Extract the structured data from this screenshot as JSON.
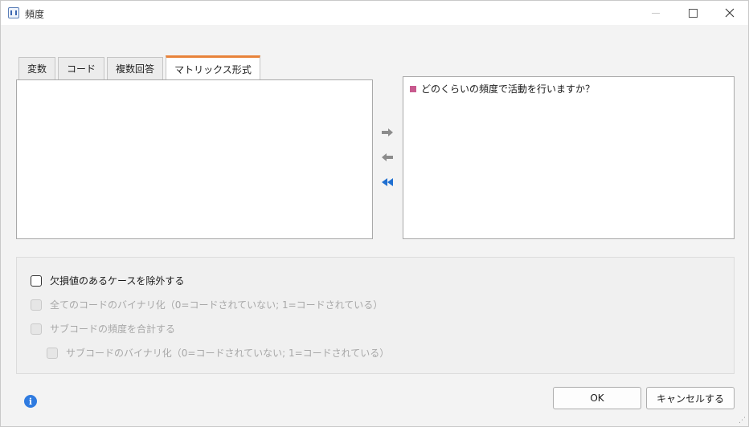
{
  "window": {
    "title": "頻度"
  },
  "tabs": [
    {
      "label": "変数"
    },
    {
      "label": "コード"
    },
    {
      "label": "複数回答"
    },
    {
      "label": "マトリックス形式"
    }
  ],
  "left_list": {
    "items": []
  },
  "right_list": {
    "items": [
      {
        "label": "どのくらいの頻度で活動を行いますか？",
        "color": "#c85a8e"
      }
    ]
  },
  "transfer": {
    "add_icon": "arrow-right-icon",
    "remove_icon": "arrow-left-icon",
    "remove_all_icon": "double-chevron-left-icon"
  },
  "options": {
    "exclude_missing": {
      "label": "欠損値のあるケースを除外する",
      "checked": false,
      "enabled": true
    },
    "binarize_all": {
      "label": "全てのコードのバイナリ化（0=コードされていない; 1=コードされている）",
      "checked": false,
      "enabled": false
    },
    "sum_subcodes": {
      "label": "サブコードの頻度を合計する",
      "checked": false,
      "enabled": false
    },
    "binarize_subcodes": {
      "label": "サブコードのバイナリ化（0=コードされていない; 1=コードされている）",
      "checked": false,
      "enabled": false
    }
  },
  "footer": {
    "ok_label": "OK",
    "cancel_label": "キャンセルする"
  },
  "colors": {
    "accent_tab": "#e8833a",
    "info": "#2f7be0",
    "arrow_active": "#1f6fd1",
    "arrow_inactive": "#8c8c8c"
  }
}
